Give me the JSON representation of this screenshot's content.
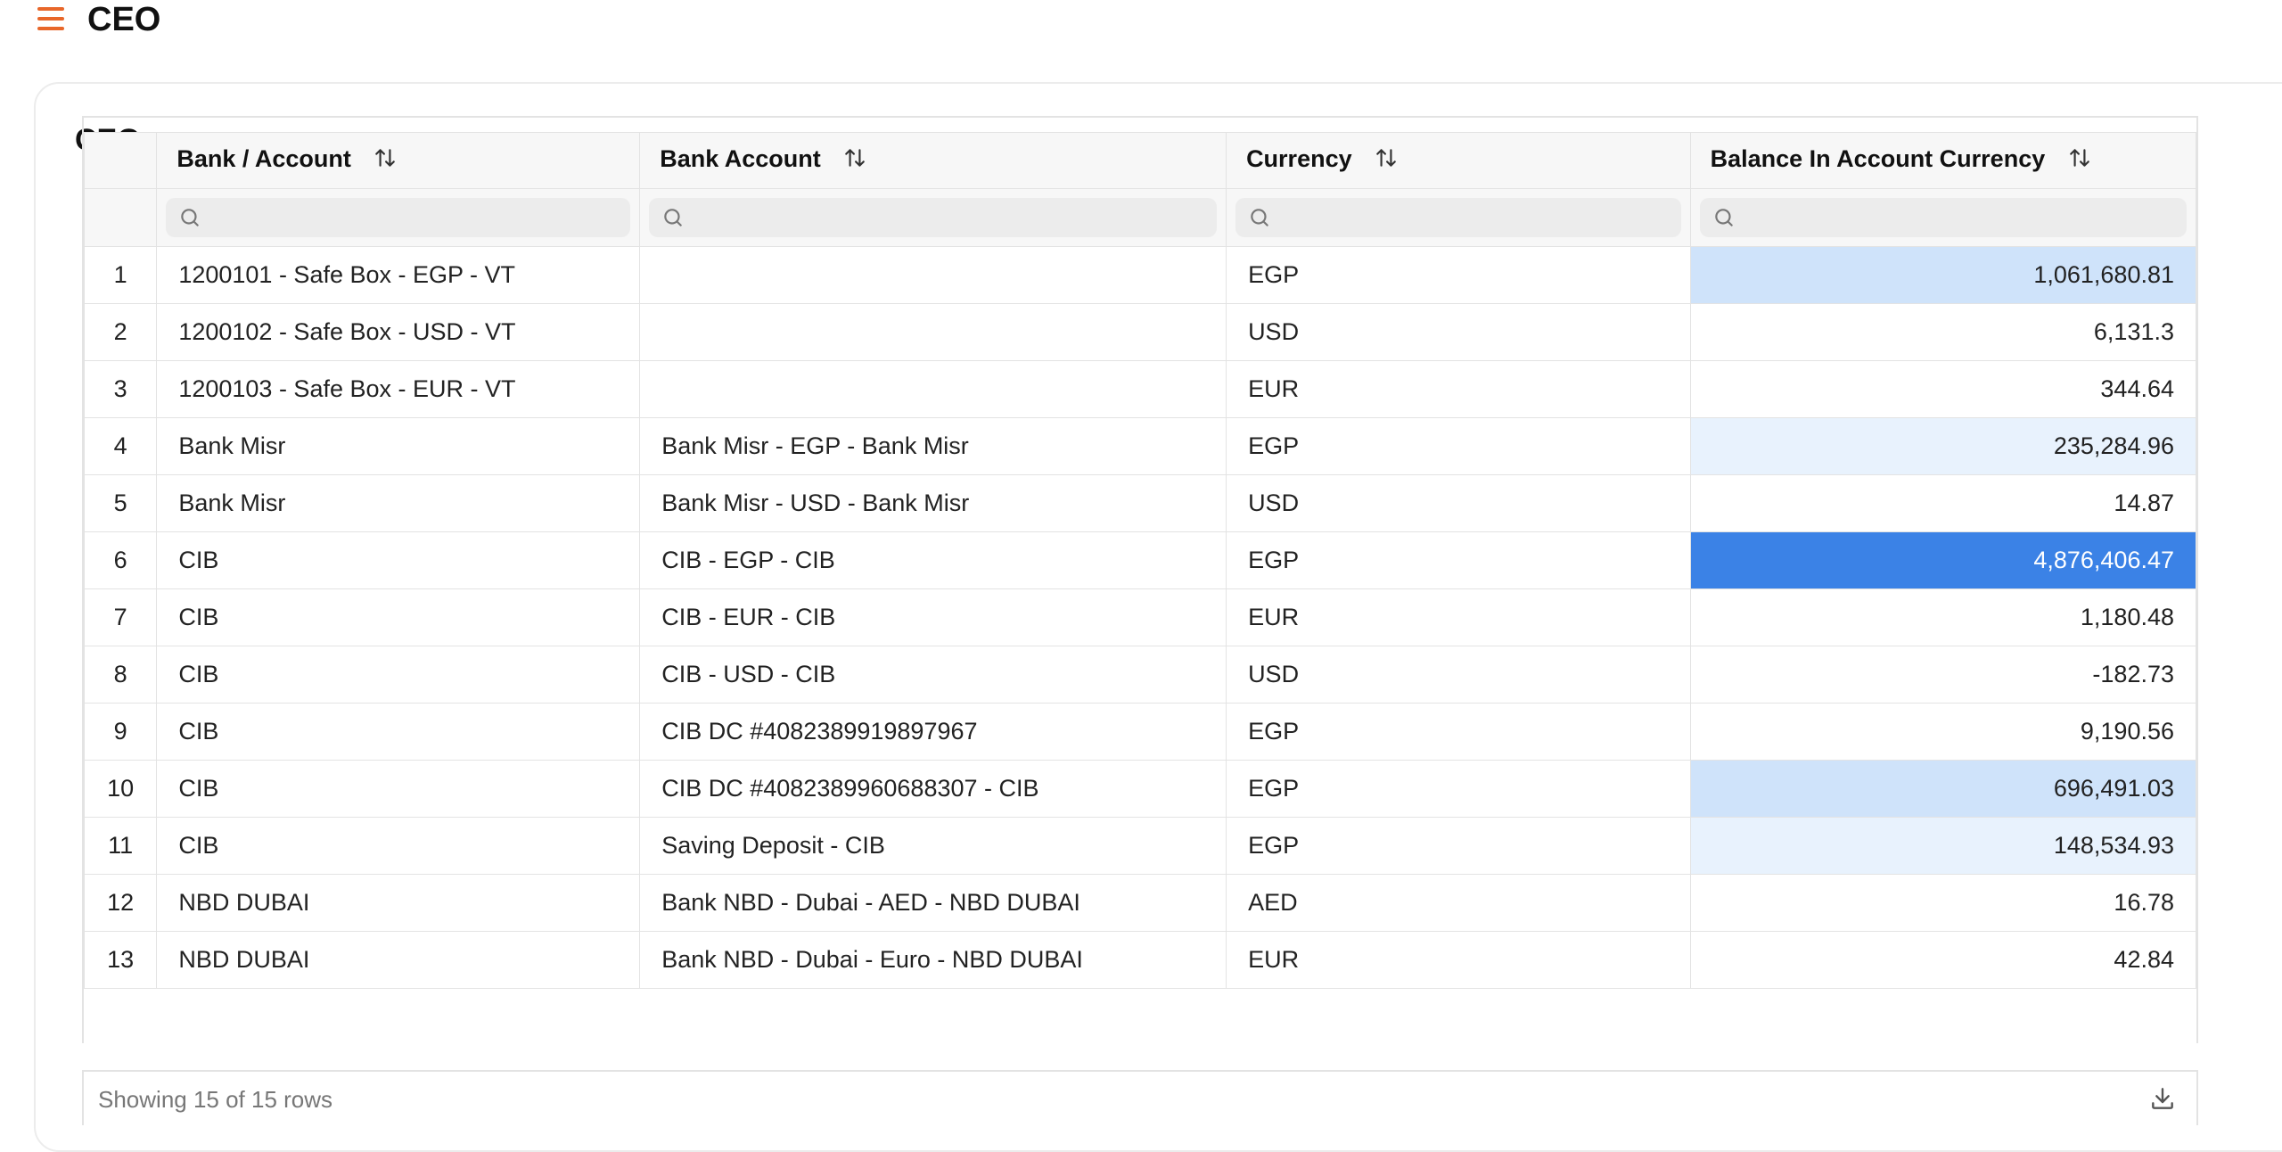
{
  "header": {
    "title": "CEO"
  },
  "card": {
    "title": "CEO"
  },
  "table": {
    "columns": [
      "Bank / Account",
      "Bank Account",
      "Currency",
      "Balance In Account Currency"
    ],
    "rows": [
      {
        "idx": "1",
        "bank": "1200101 - Safe Box - EGP - VT",
        "account": "",
        "currency": "EGP",
        "balance": "1,061,680.81",
        "heat": "#cfe3fa",
        "fg": "#222"
      },
      {
        "idx": "2",
        "bank": "1200102 - Safe Box - USD - VT",
        "account": "",
        "currency": "USD",
        "balance": "6,131.3",
        "heat": "#ffffff",
        "fg": "#222"
      },
      {
        "idx": "3",
        "bank": "1200103 - Safe Box - EUR - VT",
        "account": "",
        "currency": "EUR",
        "balance": "344.64",
        "heat": "#ffffff",
        "fg": "#222"
      },
      {
        "idx": "4",
        "bank": "Bank Misr",
        "account": "Bank Misr - EGP - Bank Misr",
        "currency": "EGP",
        "balance": "235,284.96",
        "heat": "#e8f2fd",
        "fg": "#222"
      },
      {
        "idx": "5",
        "bank": "Bank Misr",
        "account": "Bank Misr - USD - Bank Misr",
        "currency": "USD",
        "balance": "14.87",
        "heat": "#ffffff",
        "fg": "#222"
      },
      {
        "idx": "6",
        "bank": "CIB",
        "account": "CIB - EGP - CIB",
        "currency": "EGP",
        "balance": "4,876,406.47",
        "heat": "#3b82e6",
        "fg": "#ffffff"
      },
      {
        "idx": "7",
        "bank": "CIB",
        "account": "CIB - EUR - CIB",
        "currency": "EUR",
        "balance": "1,180.48",
        "heat": "#ffffff",
        "fg": "#222"
      },
      {
        "idx": "8",
        "bank": "CIB",
        "account": "CIB - USD - CIB",
        "currency": "USD",
        "balance": "-182.73",
        "heat": "#ffffff",
        "fg": "#222"
      },
      {
        "idx": "9",
        "bank": "CIB",
        "account": "CIB DC #4082389919897967",
        "currency": "EGP",
        "balance": "9,190.56",
        "heat": "#ffffff",
        "fg": "#222"
      },
      {
        "idx": "10",
        "bank": "CIB",
        "account": "CIB DC #4082389960688307 - CIB",
        "currency": "EGP",
        "balance": "696,491.03",
        "heat": "#cfe3fa",
        "fg": "#222"
      },
      {
        "idx": "11",
        "bank": "CIB",
        "account": "Saving Deposit - CIB",
        "currency": "EGP",
        "balance": "148,534.93",
        "heat": "#e8f2fd",
        "fg": "#222"
      },
      {
        "idx": "12",
        "bank": "NBD DUBAI",
        "account": "Bank NBD - Dubai - AED - NBD DUBAI",
        "currency": "AED",
        "balance": "16.78",
        "heat": "#ffffff",
        "fg": "#222"
      },
      {
        "idx": "13",
        "bank": "NBD DUBAI",
        "account": "Bank NBD - Dubai - Euro - NBD DUBAI",
        "currency": "EUR",
        "balance": "42.84",
        "heat": "#ffffff",
        "fg": "#222"
      }
    ]
  },
  "footer": {
    "status": "Showing 15 of 15 rows"
  },
  "colors": {
    "accent": "#e8672a",
    "heat_max": "#3b82e6"
  }
}
